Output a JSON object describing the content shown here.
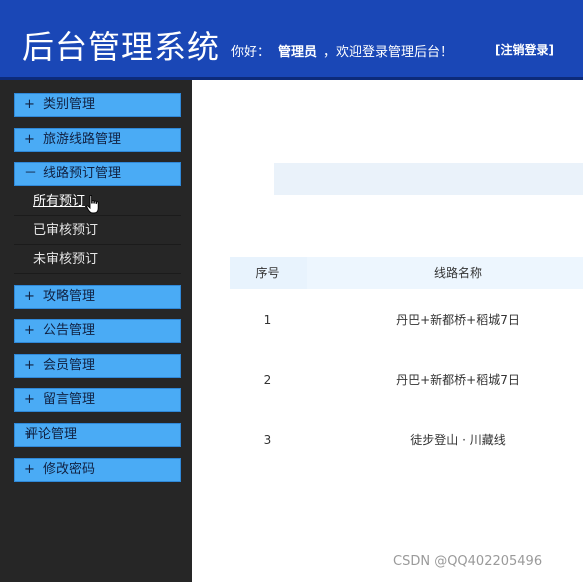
{
  "header": {
    "title": "后台管理系统",
    "greeting_prefix": "你好：",
    "user": "管理员",
    "greeting_suffix": "，欢迎登录管理后台！",
    "logout_label": "[注销登录]"
  },
  "sidebar": {
    "items": [
      {
        "sign": "+",
        "label": "类别管理"
      },
      {
        "sign": "+",
        "label": "旅游线路管理"
      },
      {
        "sign": "－",
        "label": "线路预订管理"
      },
      {
        "sign": "+",
        "label": "攻略管理"
      },
      {
        "sign": "+",
        "label": "公告管理"
      },
      {
        "sign": "+",
        "label": "会员管理"
      },
      {
        "sign": "+",
        "label": "留言管理"
      },
      {
        "sign": "+",
        "label": "评论管理"
      },
      {
        "sign": "+",
        "label": "修改密码"
      }
    ],
    "subitems": [
      {
        "label": "所有预订"
      },
      {
        "label": "已审核预订"
      },
      {
        "label": "未审核预订"
      }
    ]
  },
  "table": {
    "headers": {
      "no": "序号",
      "name": "线路名称"
    },
    "rows": [
      {
        "no": "1",
        "name": "丹巴+新都桥+稻城7日"
      },
      {
        "no": "2",
        "name": "丹巴+新都桥+稻城7日"
      },
      {
        "no": "3",
        "name": "徒步登山 · 川藏线"
      }
    ]
  },
  "watermark": "CSDN @QQ402205496",
  "colors": {
    "header_bg": "#1a47b6",
    "sidebar_bg": "#262626",
    "menu_item_bg": "#4aabf5",
    "table_header_bg": "#e8f3fd"
  },
  "icons": {
    "cursor": "hand-pointer-icon"
  }
}
